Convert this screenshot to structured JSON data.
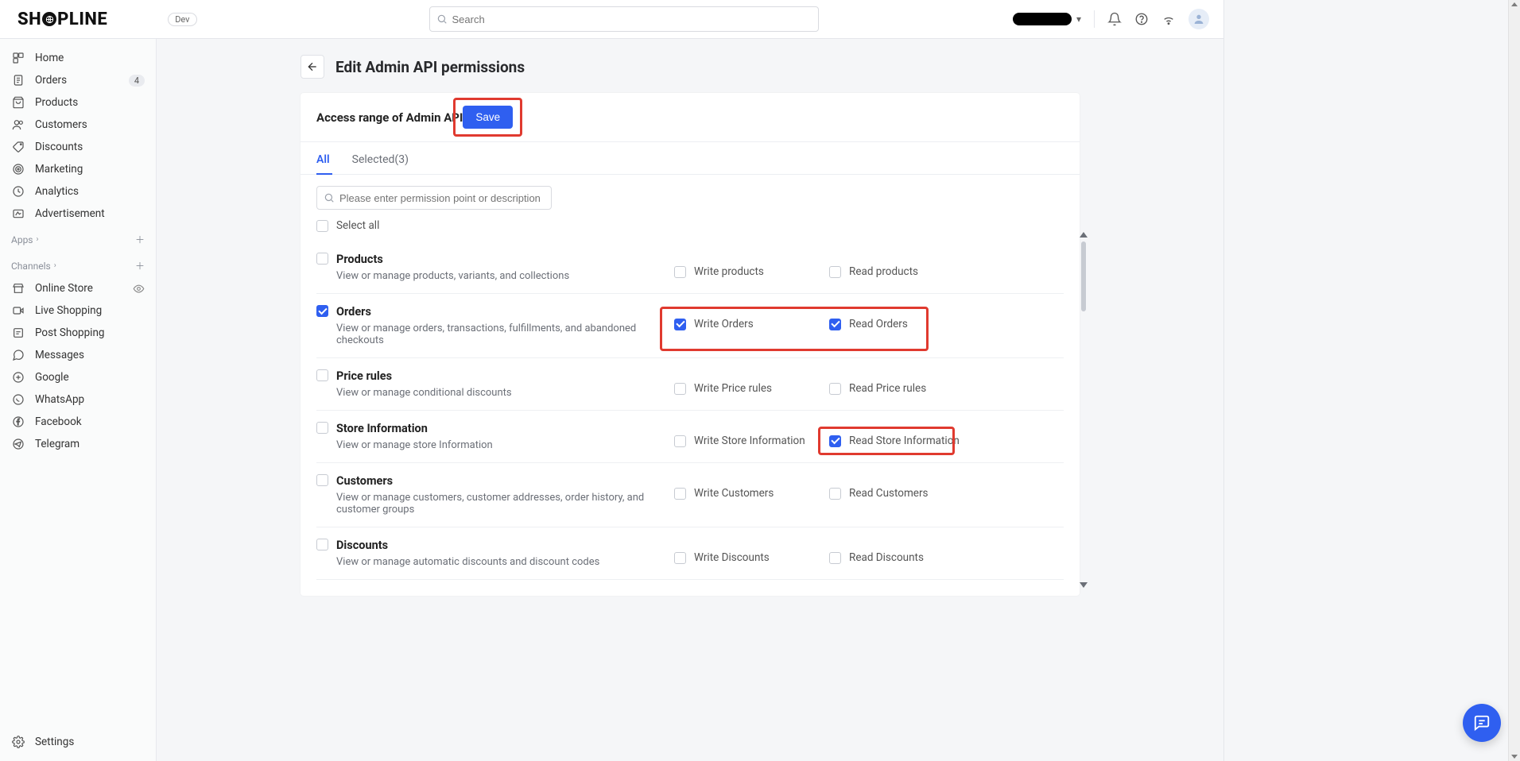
{
  "brand": {
    "prefix": "SH",
    "suffix": "PLINE"
  },
  "dev_badge": "Dev",
  "search": {
    "placeholder": "Search"
  },
  "sidebar": {
    "main": [
      {
        "label": "Home"
      },
      {
        "label": "Orders",
        "badge": "4"
      },
      {
        "label": "Products"
      },
      {
        "label": "Customers"
      },
      {
        "label": "Discounts"
      },
      {
        "label": "Marketing"
      },
      {
        "label": "Analytics"
      },
      {
        "label": "Advertisement"
      }
    ],
    "apps_head": "Apps",
    "channels_head": "Channels",
    "channels": [
      {
        "label": "Online Store",
        "eye": true
      },
      {
        "label": "Live Shopping"
      },
      {
        "label": "Post Shopping"
      },
      {
        "label": "Messages"
      },
      {
        "label": "Google"
      },
      {
        "label": "WhatsApp"
      },
      {
        "label": "Facebook"
      },
      {
        "label": "Telegram"
      }
    ],
    "settings": "Settings"
  },
  "page": {
    "title": "Edit Admin API permissions",
    "card_title": "Access range of Admin API",
    "save": "Save",
    "tab_all": "All",
    "tab_selected": "Selected(3)",
    "filter_placeholder": "Please enter permission point or description",
    "select_all": "Select all"
  },
  "permissions": [
    {
      "name": "Products",
      "desc": "View or manage products, variants, and collections",
      "checked": false,
      "write": {
        "label": "Write products",
        "checked": false
      },
      "read": {
        "label": "Read products",
        "checked": false
      }
    },
    {
      "name": "Orders",
      "desc": "View or manage orders, transactions, fulfillments, and abandoned checkouts",
      "checked": true,
      "write": {
        "label": "Write Orders",
        "checked": true
      },
      "read": {
        "label": "Read Orders",
        "checked": true
      },
      "highlight": "both"
    },
    {
      "name": "Price rules",
      "desc": "View or manage conditional discounts",
      "checked": false,
      "write": {
        "label": "Write Price rules",
        "checked": false
      },
      "read": {
        "label": "Read Price rules",
        "checked": false
      }
    },
    {
      "name": "Store Information",
      "desc": "View or manage store Information",
      "checked": false,
      "write": {
        "label": "Write Store Information",
        "checked": false
      },
      "read": {
        "label": "Read Store Information",
        "checked": true
      },
      "highlight": "read"
    },
    {
      "name": "Customers",
      "desc": "View or manage customers, customer addresses, order history, and customer groups",
      "checked": false,
      "write": {
        "label": "Write Customers",
        "checked": false
      },
      "read": {
        "label": "Read Customers",
        "checked": false
      }
    },
    {
      "name": "Discounts",
      "desc": "View or manage automatic discounts and discount codes",
      "checked": false,
      "write": {
        "label": "Write Discounts",
        "checked": false
      },
      "read": {
        "label": "Read Discounts",
        "checked": false
      }
    }
  ]
}
